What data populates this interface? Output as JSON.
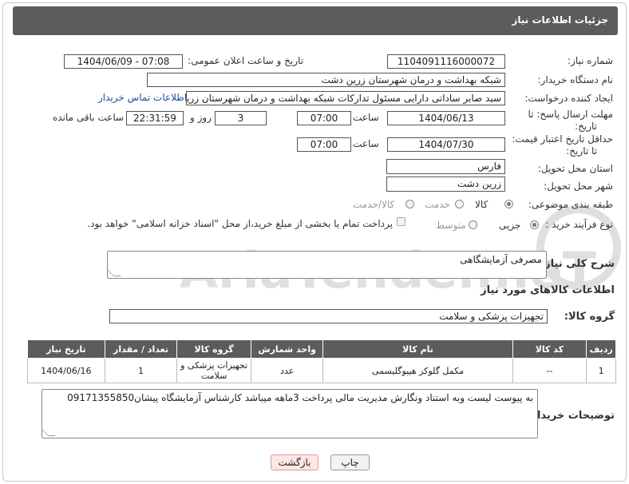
{
  "header": {
    "title": "جزئیات اطلاعات نیاز"
  },
  "form": {
    "need_number_label": "شماره نیاز:",
    "need_number": "1104091116000072",
    "announce_label": "تاریخ و ساعت اعلان عمومی:",
    "announce_value": "1404/06/09 - 07:08",
    "buyer_org_label": "نام دستگاه خریدار:",
    "buyer_org": "شبکه بهداشت و درمان شهرستان زرین دشت",
    "creator_label": "ایجاد کننده درخواست:",
    "creator": "سید صابر ساداتی دارایی مسئول تدارکات شبکه بهداشت و درمان شهرستان زرین دشت",
    "contact_link": "اطلاعات تماس خریدار",
    "deadline_label_1": "مهلت ارسال پاسخ: تا",
    "deadline_label_2": "تاریخ:",
    "deadline_date": "1404/06/13",
    "time_word": "ساعت",
    "deadline_time": "07:00",
    "days_value": "3",
    "days_word": "روز و",
    "remaining_time": "22:31:59",
    "remaining_word": "ساعت باقی مانده",
    "min_price_label_1": "حداقل تاریخ اعتبار قیمت:",
    "min_price_label_2": "تا تاریخ:",
    "validity_date": "1404/07/30",
    "validity_time": "07:00",
    "province_label": "استان محل تحویل:",
    "province": "فارس",
    "city_label": "شهر محل تحویل:",
    "city": "زرین دشت",
    "category_label": "طبقه بندی موضوعی:",
    "category_options": [
      "کالا",
      "خدمت",
      "کالا/خدمت"
    ],
    "category_selected": "کالا",
    "process_label": "نوع فرآیند خرید :",
    "process_options": [
      "جزیی",
      "متوسط"
    ],
    "process_selected": "جزیی",
    "payment_note": "پرداخت تمام یا بخشی از مبلغ خرید،از محل \"اسناد خزانه اسلامی\" خواهد بود.",
    "summary_label": "شرح کلی نیاز:",
    "summary": "مصرفی آزمایشگاهی",
    "goods_info_title": "اطلاعات کالاهای مورد نیاز",
    "goods_group_label": "گروه کالا:",
    "goods_group": "تجهیزات پزشکی و سلامت"
  },
  "table": {
    "columns": [
      "ردیف",
      "کد کالا",
      "نام کالا",
      "واحد شمارش",
      "گروه کالا",
      "تعداد / مقدار",
      "تاریخ نیاز"
    ],
    "rows": [
      [
        "1",
        "--",
        "مکمل گلوکز هیپوگلیسمی",
        "عدد",
        "تجهیزات پزشکی و سلامت",
        "1",
        "1404/06/16"
      ]
    ]
  },
  "buyer_notes_label": "توضیحات خریدار:",
  "buyer_notes": "به پیوست لیست وبه استناد ونگارش مدیریت مالی پرداخت 3ماهه میباشد کارشناس آزمایشگاه پیشان09171355850",
  "buttons": {
    "print": "چاپ",
    "back": "بازگشت"
  },
  "watermark_text": "AriaTender.neT",
  "colors": {
    "header_bg": "#5c5c5c",
    "link": "#1a4fa0",
    "back_button_bg": "#fde6e6"
  }
}
